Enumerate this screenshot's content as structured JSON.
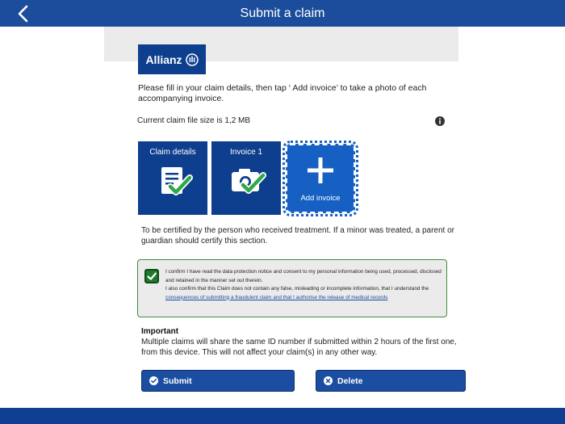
{
  "header": {
    "title": "Submit a claim",
    "back_icon": "chevron-left-icon"
  },
  "logo": {
    "text": "Allianz",
    "icon": "allianz-eagle-icon"
  },
  "intro_text": "Please fill in your claim details, then tap ‘ Add invoice’ to take a photo of each accompanying invoice.",
  "file_size_text": "Current claim file size is 1,2 MB",
  "tiles": {
    "claim_details": {
      "label": "Claim details",
      "icon": "document-check-icon"
    },
    "invoice_1": {
      "label": "Invoice 1",
      "icon": "camera-check-icon"
    },
    "add_invoice": {
      "label": "Add invoice",
      "icon": "plus-icon"
    }
  },
  "certify_text": "To be certified by the person who received  treatment. If a minor was treated, a parent or guardian should certify this section.",
  "consent": {
    "checked": true,
    "line1": "I confirm I have read the data protection notice and consent to my personal information being used, processed, disclosed and retained in the manner set out therein.",
    "line2": "I also confirm that this Claim does not contain any false, misleading or incomplete information, that I understand the",
    "link": " consequences of submitting a fraudulent claim and that I authorise the release of medical records"
  },
  "important": {
    "title": "Important",
    "body": "Multiple claims will share the same ID number if submitted within 2 hours of the first one, from this device. This will not affect your claim(s) in any other way."
  },
  "buttons": {
    "submit": "Submit",
    "delete": "Delete"
  },
  "colors": {
    "header_blue": "#1c4d9c",
    "tile_navy": "#0e3e8e",
    "add_tile_blue": "#1560c2",
    "check_green": "#2ea84a"
  }
}
